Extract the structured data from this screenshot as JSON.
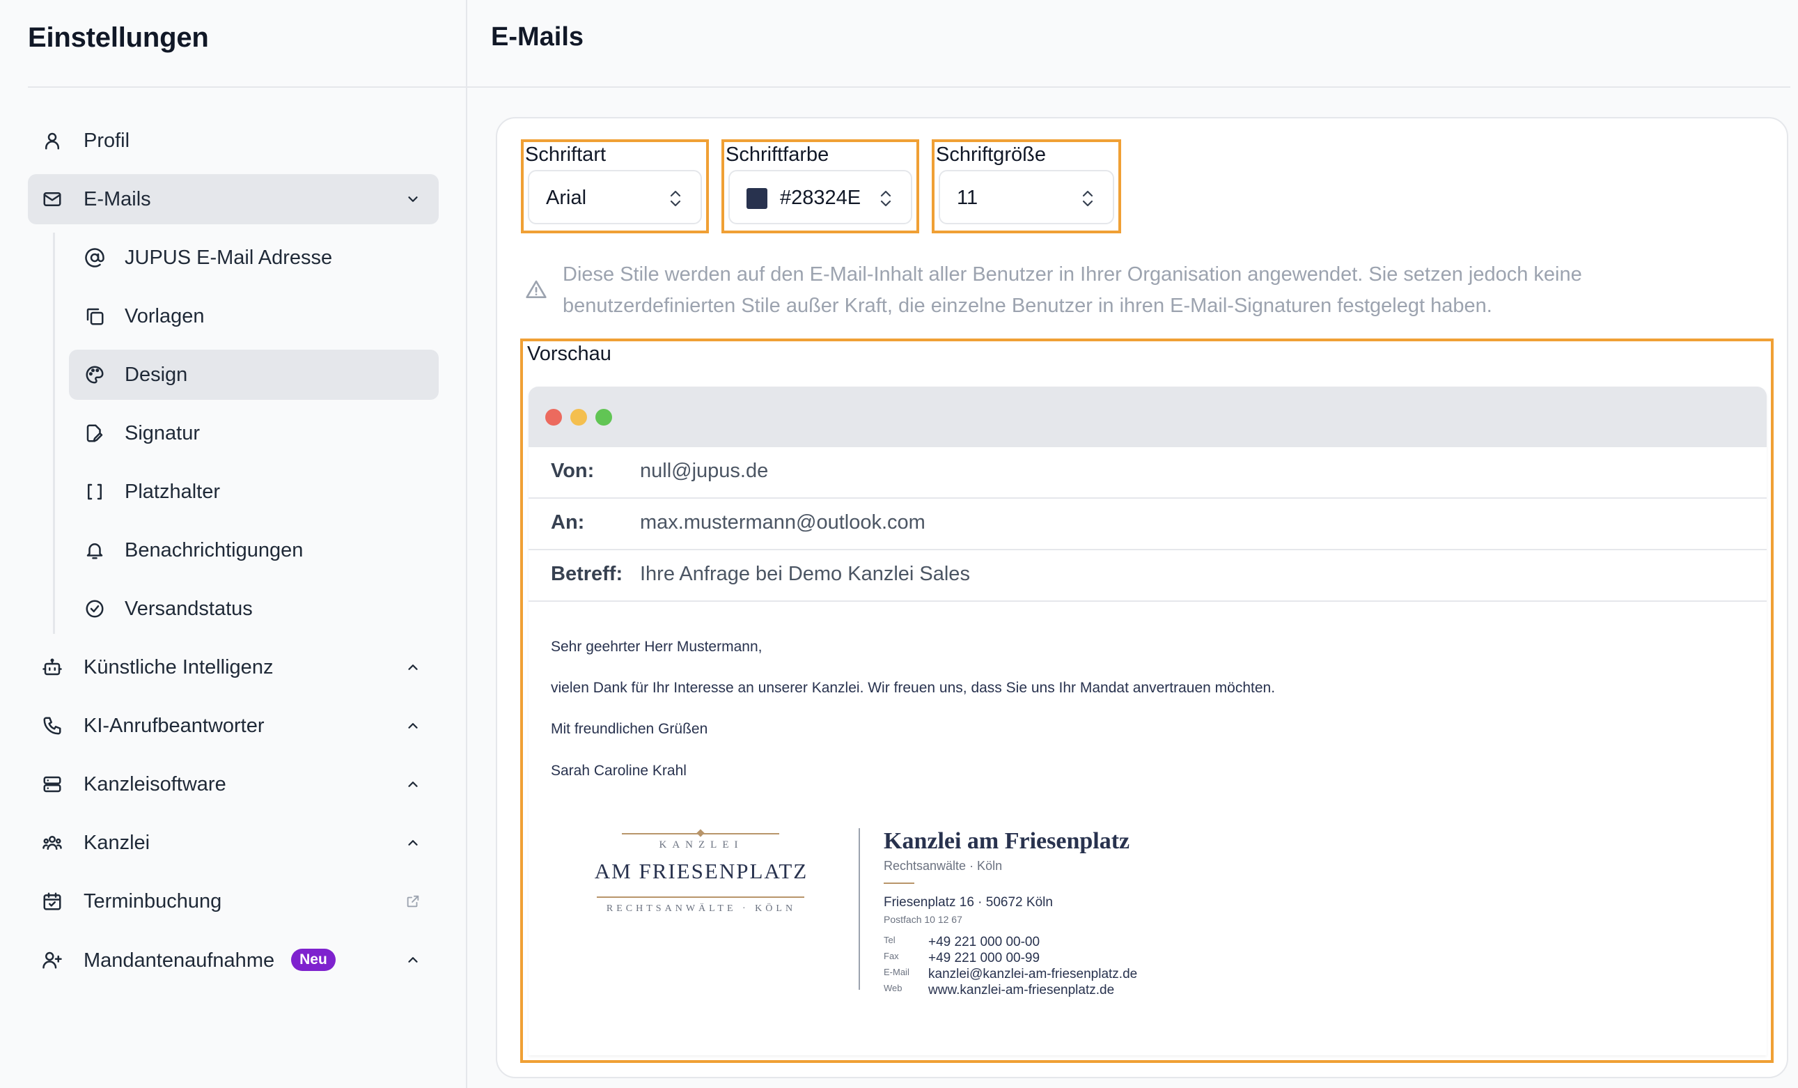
{
  "sidebar": {
    "title": "Einstellungen",
    "items": [
      {
        "label": "Profil",
        "icon": "user-icon"
      },
      {
        "label": "E-Mails",
        "icon": "mail-icon",
        "expanded": true
      },
      {
        "label": "Künstliche Intelligenz",
        "icon": "bot-icon"
      },
      {
        "label": "KI-Anrufbeantworter",
        "icon": "phone-icon"
      },
      {
        "label": "Kanzleisoftware",
        "icon": "server-icon"
      },
      {
        "label": "Kanzlei",
        "icon": "users-icon"
      },
      {
        "label": "Terminbuchung",
        "icon": "calendar-check-icon"
      },
      {
        "label": "Mandantenaufnahme",
        "icon": "user-plus-icon",
        "badge": "Neu"
      }
    ],
    "email_subitems": [
      {
        "label": "JUPUS E-Mail Adresse",
        "icon": "at-sign-icon"
      },
      {
        "label": "Vorlagen",
        "icon": "copy-icon"
      },
      {
        "label": "Design",
        "icon": "palette-icon",
        "active": true
      },
      {
        "label": "Signatur",
        "icon": "file-pen-icon"
      },
      {
        "label": "Platzhalter",
        "icon": "brackets-icon"
      },
      {
        "label": "Benachrichtigungen",
        "icon": "bell-icon"
      },
      {
        "label": "Versandstatus",
        "icon": "check-circle-icon"
      }
    ]
  },
  "main": {
    "title": "E-Mails",
    "fields": {
      "font": {
        "label": "Schriftart",
        "value": "Arial"
      },
      "color": {
        "label": "Schriftfarbe",
        "value": "#28324E",
        "swatch": "#28324e"
      },
      "size": {
        "label": "Schriftgröße",
        "value": "11"
      }
    },
    "notice": "Diese Stile werden auf den E-Mail-Inhalt aller Benutzer in Ihrer Organisation angewendet. Sie setzen jedoch keine benutzerdefinierten Stile außer Kraft, die einzelne Benutzer in ihren E-Mail-Signaturen festgelegt haben.",
    "preview": {
      "label": "Vorschau",
      "from_key": "Von:",
      "from": "null@jupus.de",
      "to_key": "An:",
      "to": "max.mustermann@outlook.com",
      "subject_key": "Betreff:",
      "subject": "Ihre Anfrage bei Demo Kanzlei Sales",
      "body": [
        "Sehr geehrter Herr Mustermann,",
        "vielen Dank für Ihr Interesse an unserer Kanzlei. Wir freuen uns, dass Sie uns Ihr Mandat anvertrauen möchten.",
        "Mit freundlichen Grüßen",
        "Sarah Caroline Krahl"
      ],
      "signature": {
        "logo_top": "KANZLEI",
        "logo_main": "AM FRIESENPLATZ",
        "logo_bottom": "RECHTSANWÄLTE · KÖLN",
        "name": "Kanzlei am Friesenplatz",
        "subtitle": "Rechtsanwälte · Köln",
        "address": "Friesenplatz 16  ·  50672 Köln",
        "po_box": "Postfach 10 12 67",
        "contacts": [
          {
            "key": "Tel",
            "value": "+49 221 000 00-00"
          },
          {
            "key": "Fax",
            "value": "+49 221 000 00-99"
          },
          {
            "key": "E-Mail",
            "value": "kanzlei@kanzlei-am-friesenplatz.de"
          },
          {
            "key": "Web",
            "value": "www.kanzlei-am-friesenplatz.de"
          }
        ]
      }
    }
  },
  "colors": {
    "accent_outline": "#f0a035",
    "text_color": "#28324e",
    "badge": "#7e22ce"
  }
}
